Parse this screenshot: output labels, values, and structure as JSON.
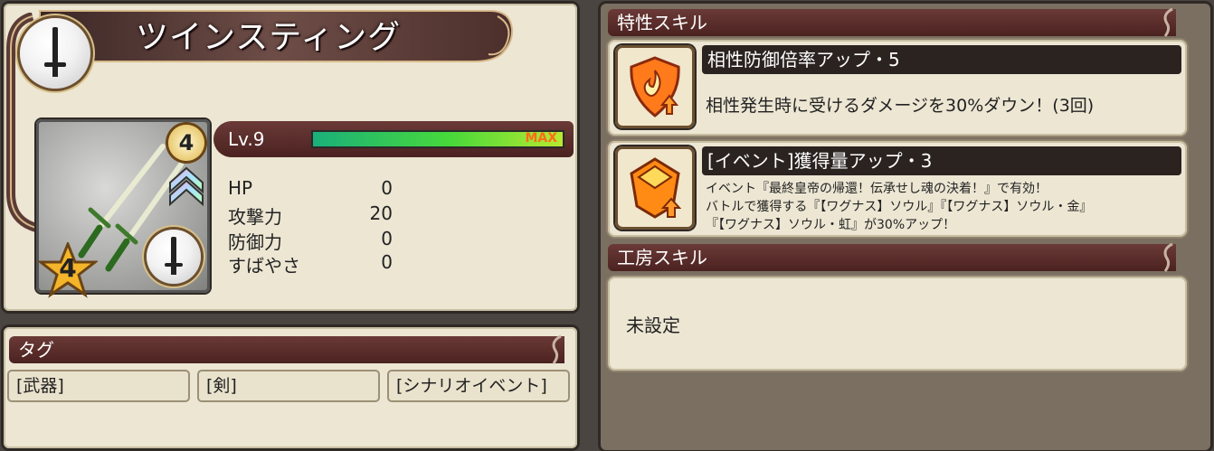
{
  "weapon": {
    "name": "ツインスティング",
    "level_label": "Lv.9",
    "level_max_label": "MAX",
    "level_progress": 1.0,
    "rarity_number": "4",
    "star_number": "4",
    "type_icon": "sword-icon"
  },
  "stats": [
    {
      "label": "HP",
      "value": "0"
    },
    {
      "label": "攻撃力",
      "value": "20"
    },
    {
      "label": "防御力",
      "value": "0"
    },
    {
      "label": "すばやさ",
      "value": "0"
    }
  ],
  "tags": {
    "header": "タグ",
    "items": [
      "[武器]",
      "[剣]",
      "[シナリオイベント]"
    ]
  },
  "traits": {
    "header": "特性スキル",
    "skills": [
      {
        "title": "相性防御倍率アップ・5",
        "desc_lines": [
          "相性発生時に受けるダメージを30%ダウン！(3回)"
        ],
        "icon": "flame-shield-icon"
      },
      {
        "title": "[イベント]獲得量アップ・3",
        "desc_lines": [
          "イベント『最終皇帝の帰還！伝承せし魂の決着！』で有効！",
          "バトルで獲得する『【ワグナス】ソウル』『【ワグナス】ソウル・金』",
          "『【ワグナス】ソウル・虹』が30%アップ！"
        ],
        "icon": "gem-up-icon"
      }
    ]
  },
  "workshop": {
    "header": "工房スキル",
    "value": "未設定"
  },
  "colors": {
    "bar": "#5a2c2a",
    "panel": "#ece6d3",
    "frame": "#2e2925",
    "gauge": "#3bd13b"
  }
}
